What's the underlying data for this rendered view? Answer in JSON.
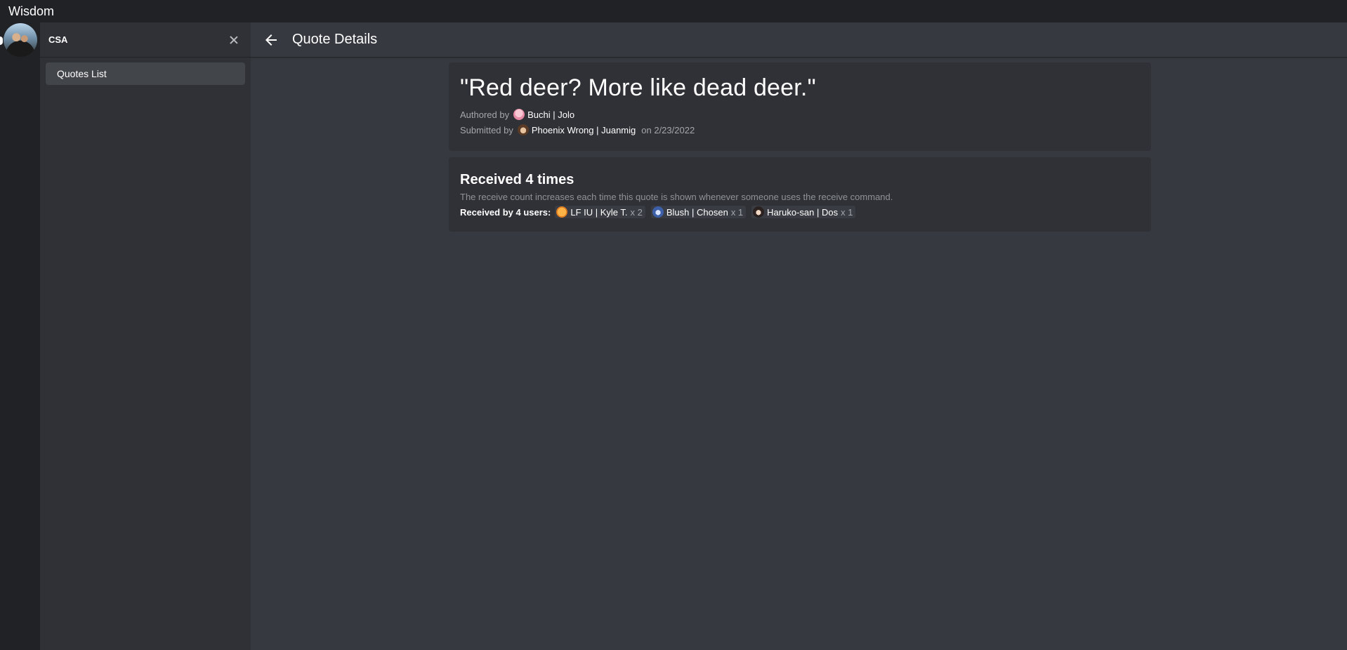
{
  "app": {
    "title": "Wisdom"
  },
  "server": {
    "name": "CSA"
  },
  "sidebar": {
    "items": [
      {
        "label": "Quotes List"
      }
    ]
  },
  "header": {
    "title": "Quote Details",
    "back_icon": "arrow-left-icon"
  },
  "quote": {
    "text": "\"Red deer? More like dead deer.\"",
    "authored_label": "Authored by",
    "author": "Buchi | Jolo",
    "submitted_label": "Submitted by",
    "submitter": "Phoenix Wrong | Juanmig",
    "date_text": "on 2/23/2022"
  },
  "receive": {
    "title": "Received 4 times",
    "description": "The receive count increases each time this quote is shown whenever someone uses the receive command.",
    "received_by_label": "Received by 4 users:",
    "users": [
      {
        "name": "LF IU | Kyle T.",
        "count": "x 2"
      },
      {
        "name": "Blush | Chosen",
        "count": "x 1"
      },
      {
        "name": "Haruko-san | Dos",
        "count": "x 1"
      }
    ]
  },
  "colors": {
    "background": "#36393f",
    "sidebar": "#2f3136",
    "rail": "#202225",
    "card": "#2f3136",
    "muted_text": "#a3a6aa"
  }
}
